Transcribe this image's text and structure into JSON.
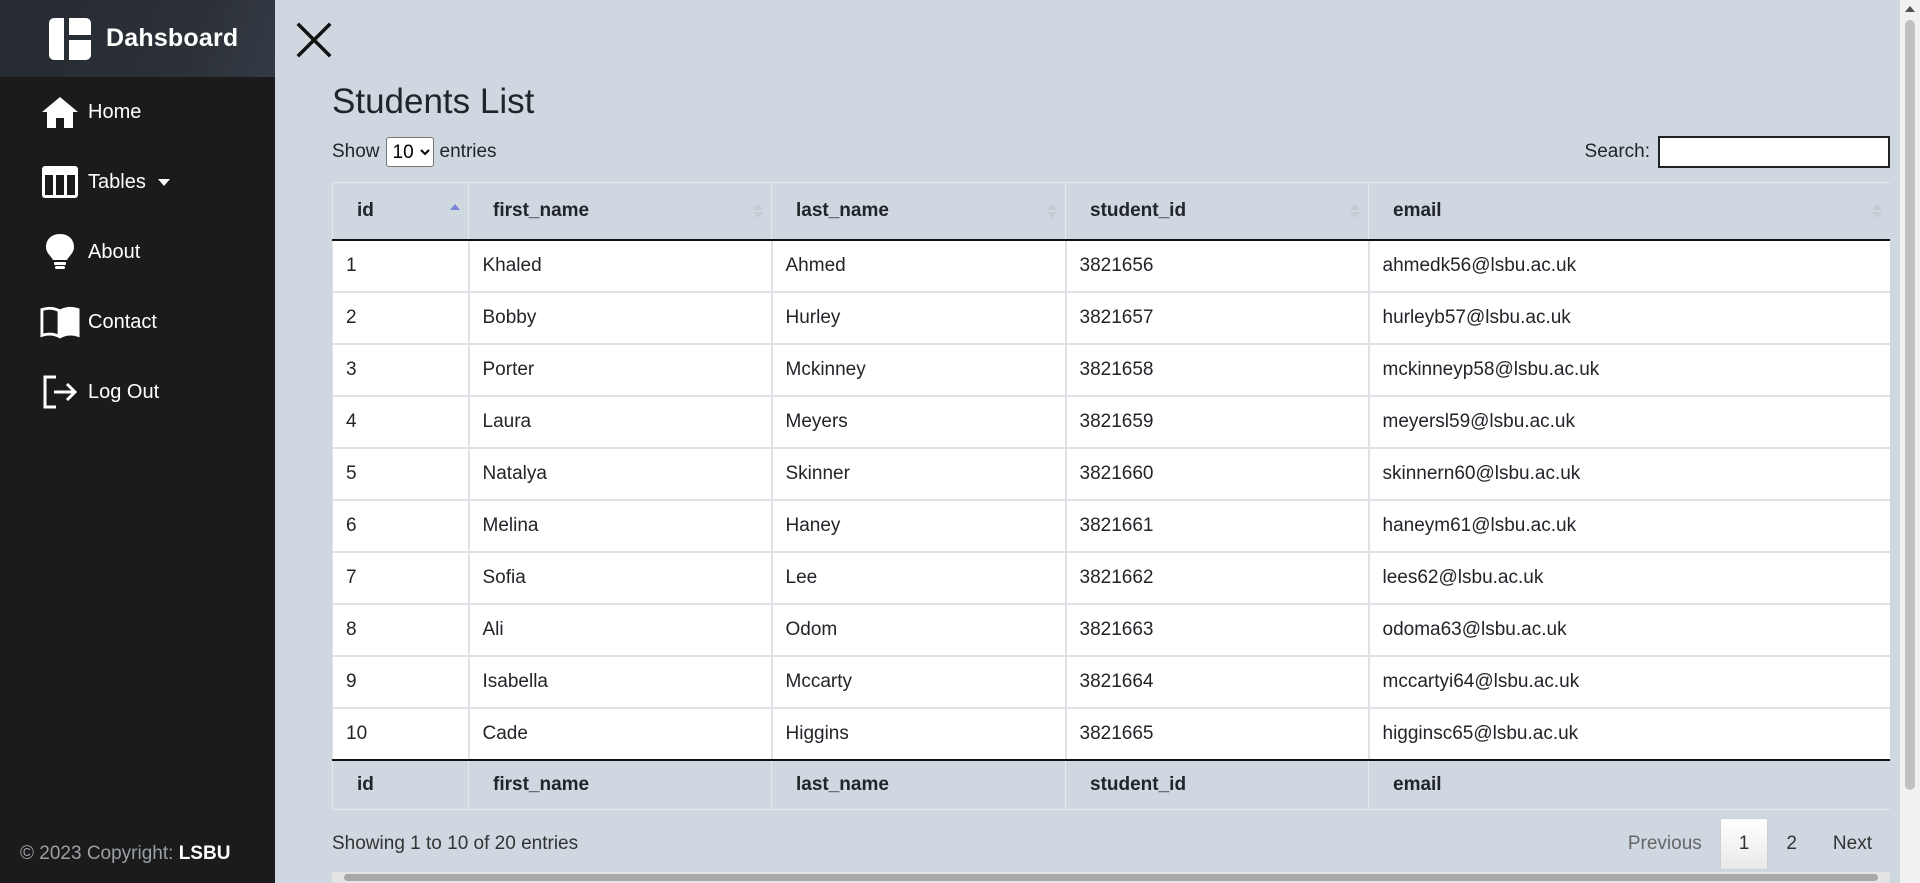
{
  "sidebar": {
    "brand": "Dahsboard",
    "items": [
      {
        "label": "Home",
        "icon": "home-icon"
      },
      {
        "label": "Tables",
        "icon": "table-icon",
        "dropdown": true
      },
      {
        "label": "About",
        "icon": "lightbulb-icon"
      },
      {
        "label": "Contact",
        "icon": "book-icon"
      },
      {
        "label": "Log Out",
        "icon": "logout-icon"
      }
    ],
    "footer_prefix": "© 2023 Copyright: ",
    "footer_brand": "LSBU"
  },
  "main": {
    "title": "Students List",
    "length": {
      "prefix": "Show",
      "selected": "10",
      "suffix": "entries"
    },
    "search_label": "Search:",
    "search_value": "",
    "columns": [
      "id",
      "first_name",
      "last_name",
      "student_id",
      "email"
    ],
    "rows": [
      [
        "1",
        "Khaled",
        "Ahmed",
        "3821656",
        "ahmedk56@lsbu.ac.uk"
      ],
      [
        "2",
        "Bobby",
        "Hurley",
        "3821657",
        "hurleyb57@lsbu.ac.uk"
      ],
      [
        "3",
        "Porter",
        "Mckinney",
        "3821658",
        "mckinneyp58@lsbu.ac.uk"
      ],
      [
        "4",
        "Laura",
        "Meyers",
        "3821659",
        "meyersl59@lsbu.ac.uk"
      ],
      [
        "5",
        "Natalya",
        "Skinner",
        "3821660",
        "skinnern60@lsbu.ac.uk"
      ],
      [
        "6",
        "Melina",
        "Haney",
        "3821661",
        "haneym61@lsbu.ac.uk"
      ],
      [
        "7",
        "Sofia",
        "Lee",
        "3821662",
        "lees62@lsbu.ac.uk"
      ],
      [
        "8",
        "Ali",
        "Odom",
        "3821663",
        "odoma63@lsbu.ac.uk"
      ],
      [
        "9",
        "Isabella",
        "Mccarty",
        "3821664",
        "mccartyi64@lsbu.ac.uk"
      ],
      [
        "10",
        "Cade",
        "Higgins",
        "3821665",
        "higginsc65@lsbu.ac.uk"
      ]
    ],
    "info": "Showing 1 to 10 of 20 entries",
    "pagination": {
      "previous": "Previous",
      "pages": [
        "1",
        "2"
      ],
      "current": "1",
      "next": "Next"
    }
  },
  "colors": {
    "sidebar": "#1b1b1b",
    "main_bg": "#cfd8e0",
    "sort_active": "#7a84d4"
  }
}
